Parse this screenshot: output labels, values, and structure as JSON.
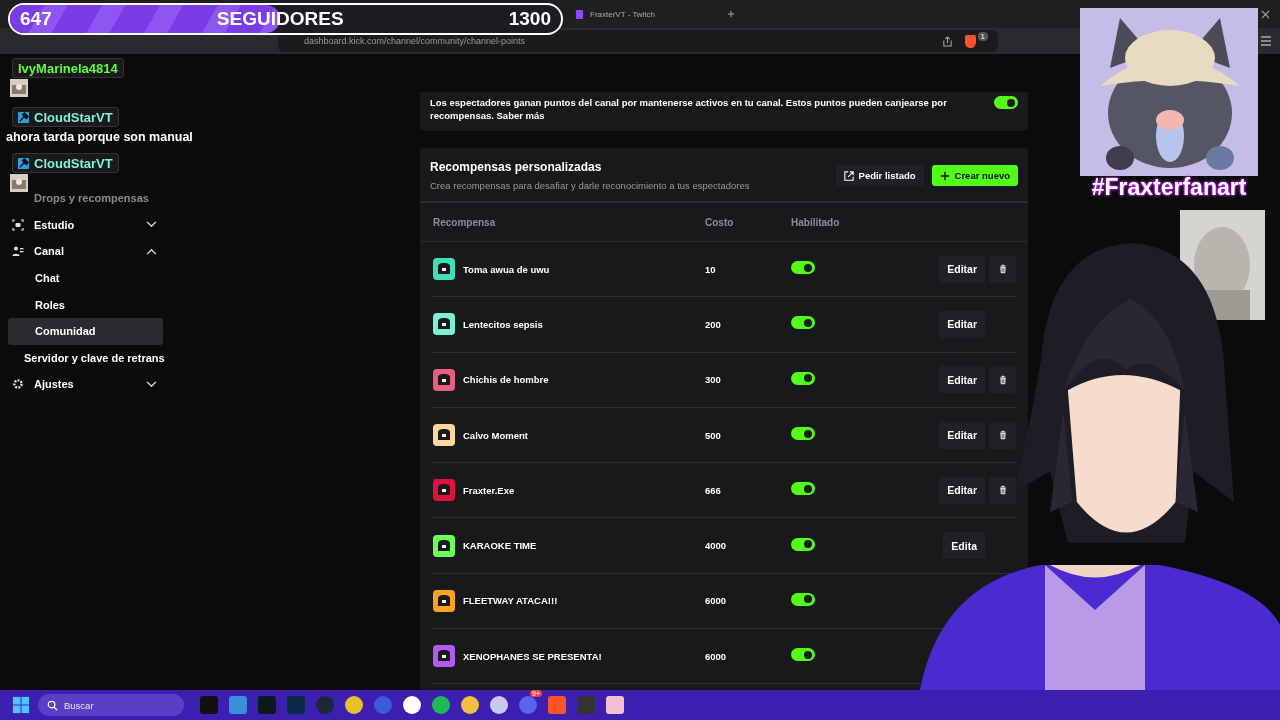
{
  "browser": {
    "tab_title": "FraxterVT - Twitch",
    "url": "dashboard.kick.com/channel/community/channel-points",
    "extension_badge": "1"
  },
  "follower_goal": {
    "current": "647",
    "label": "SEGUIDORES",
    "target": "1300",
    "level": 0.49
  },
  "chat_overlay": [
    {
      "kind": "user",
      "name": "IvyMarinela4814",
      "color": "#5cff3a",
      "badge": false,
      "avatar": true
    },
    {
      "kind": "user",
      "name": "CloudStarVT",
      "color": "#7ff3d5",
      "badge": true,
      "avatar": false
    },
    {
      "kind": "message",
      "text": "ahora tarda porque son manual"
    },
    {
      "kind": "user",
      "name": "CloudStarVT",
      "color": "#7ff3d5",
      "badge": true,
      "avatar": true
    }
  ],
  "sidebar": {
    "items": [
      {
        "label": "Drops y recompensas",
        "kind": "plain",
        "dimmed": true
      },
      {
        "label": "Estudio",
        "kind": "studio",
        "dimmed": false,
        "expanded": false
      },
      {
        "label": "Canal",
        "kind": "channel",
        "dimmed": false,
        "expanded": true,
        "children": [
          {
            "label": "Chat",
            "selected": false
          },
          {
            "label": "Roles",
            "selected": false
          },
          {
            "label": "Comunidad",
            "selected": true
          }
        ]
      },
      {
        "label": "Servidor y clave de retrans",
        "kind": "plain",
        "dimmed": false
      },
      {
        "label": "Ajustes",
        "kind": "settings",
        "dimmed": false,
        "expanded": false
      }
    ]
  },
  "points_card": {
    "description": "Los espectadores ganan puntos del canal por mantenerse activos en tu canal. Estos puntos pueden canjearse por recompensas. Saber más",
    "on": true
  },
  "rewards": {
    "title": "Recompensas personalizadas",
    "subtitle": "Crea recompensas para desafiar y darle reconocimiento a tus espectadores",
    "buttons": [
      "Pedir listado",
      "Crear nuevo"
    ],
    "columns": [
      "Recompensa",
      "Costo",
      "Habilitado"
    ],
    "rows": [
      {
        "name": "Toma awua de uwu",
        "cost": "10",
        "color": "#3de0b8",
        "enabled": true,
        "edit": "Editar",
        "delete_button": true
      },
      {
        "name": "Lentecitos sepsis",
        "cost": "200",
        "color": "#7af0d8",
        "enabled": true,
        "edit": "Editar",
        "delete_button": false
      },
      {
        "name": "Chichis de hombre",
        "cost": "300",
        "color": "#e85f7e",
        "enabled": true,
        "edit": "Editar",
        "delete_button": true
      },
      {
        "name": "Calvo Moment",
        "cost": "500",
        "color": "#ffd79a",
        "enabled": true,
        "edit": "Editar",
        "delete_button": true
      },
      {
        "name": "Fraxter.Exe",
        "cost": "666",
        "color": "#e0103d",
        "enabled": true,
        "edit": "Editar",
        "delete_button": true
      },
      {
        "name": "KARAOKE TIME",
        "cost": "4000",
        "color": "#6cff5a",
        "enabled": true,
        "edit": "Edita",
        "delete_button": false
      },
      {
        "name": "FLEETWAY ATACA!!!",
        "cost": "6000",
        "color": "#ffa21f",
        "enabled": true,
        "delete_button": false
      },
      {
        "name": "XENOPHANES SE PRESENTA!",
        "cost": "6000",
        "color": "#b35af0",
        "enabled": true,
        "delete_button": false
      }
    ]
  },
  "fanart": {
    "caption": "#Fraxterfanart"
  },
  "taskbar": {
    "search_placeholder": "Buscar",
    "notification_badge": "9+"
  }
}
